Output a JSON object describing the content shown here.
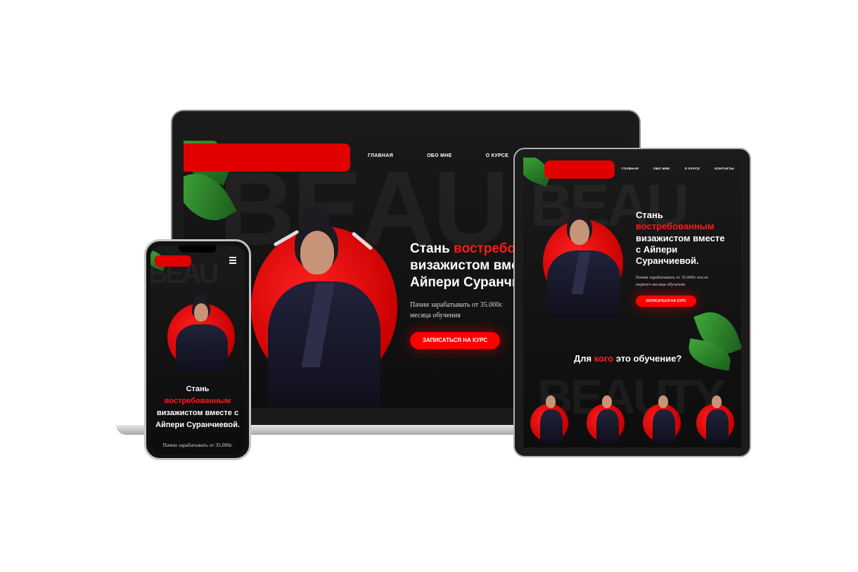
{
  "colors": {
    "accent": "#ff0000",
    "background": "#141414",
    "text": "#ffffff"
  },
  "laptop": {
    "nav": [
      "ГЛАВНАЯ",
      "ОБО МНЕ",
      "О КУРСЕ"
    ],
    "title_line1": "Стань ",
    "title_accent": "востребо",
    "title_line2": "визажистом вме",
    "title_line3": "Айпери Суранчи",
    "subtitle": "Пачни зарабатывать от 35.000с",
    "subtitle_line2": "месяца обучения",
    "cta": "ЗАПИСАТЬСЯ НА КУРС",
    "bg_word": "BEAU"
  },
  "tablet": {
    "nav": [
      "ГЛАВНАЯ",
      "ОБО МНЕ",
      "О КУРСЕ",
      "КОНТАКТЫ"
    ],
    "title_line1": "Стань",
    "title_accent": "востребованным",
    "title_line2": "визажистом вместе",
    "title_line3": "с Айпери",
    "title_line4": "Суранчиевой.",
    "subtitle": "Пачни зарабатывать от 35.000с после",
    "subtitle_line2": "первого месяца обучения",
    "cta": "ЗАПИСАТЬСЯ НА КУРС",
    "section_pre": "Для ",
    "section_accent": "кого",
    "section_post": " это обучение?",
    "bg_word": "BEAU",
    "bg_word2": "BEAUTY"
  },
  "phone": {
    "menu_icon": "hamburger-menu-icon",
    "title_line1": "Стань",
    "title_accent": "востребованным",
    "title_line2": "визажистом вместе с",
    "title_line3": "Айпери Суранчиевой.",
    "subtitle": "Пачни зарабатывать от 35.000с",
    "bg_word": "BEAU"
  }
}
